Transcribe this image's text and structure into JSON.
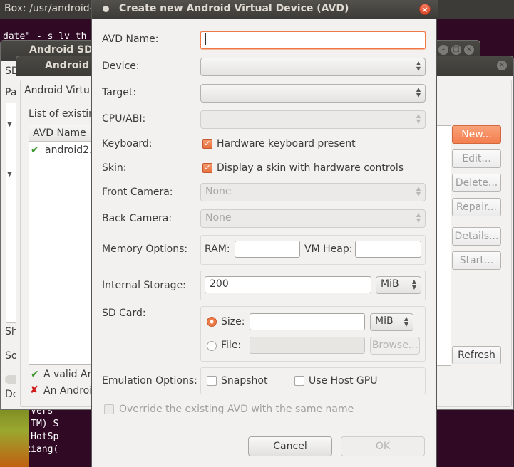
{
  "terminal": {
    "title": "Box: /usr/android-s",
    "lines": [
      "date\" - s lv th",
      "Java Vers",
      "Java(TM) S",
      "Java HotSp",
      "billxiang("
    ]
  },
  "sdk_manager": {
    "title": "Android SDK",
    "fragments": [
      "SD",
      "Pa",
      "Sh",
      "So",
      "Do"
    ]
  },
  "avd_manager": {
    "title": "Android V",
    "header": "Android Virtu",
    "list_caption": "List of existin",
    "column": "AVD Name",
    "rows": [
      "android2."
    ],
    "legend_valid": "A valid An",
    "legend_invalid": "An Androi",
    "buttons": {
      "new": "New...",
      "edit": "Edit...",
      "delete": "Delete...",
      "repair": "Repair...",
      "details": "Details...",
      "start": "Start..."
    }
  },
  "dialog": {
    "title": "Create new Android Virtual Device (AVD)",
    "avd_name": {
      "label": "AVD Name:",
      "value": ""
    },
    "device": {
      "label": "Device:",
      "value": ""
    },
    "target": {
      "label": "Target:",
      "value": ""
    },
    "cpu_abi": {
      "label": "CPU/ABI:",
      "value": ""
    },
    "keyboard": {
      "label": "Keyboard:",
      "option": "Hardware keyboard present",
      "checked": true
    },
    "skin": {
      "label": "Skin:",
      "option": "Display a skin with hardware controls",
      "checked": true
    },
    "front_camera": {
      "label": "Front Camera:",
      "value": "None"
    },
    "back_camera": {
      "label": "Back Camera:",
      "value": "None"
    },
    "memory": {
      "label": "Memory Options:",
      "ram_label": "RAM:",
      "ram_value": "",
      "heap_label": "VM Heap:",
      "heap_value": ""
    },
    "internal_storage": {
      "label": "Internal Storage:",
      "value": "200",
      "unit": "MiB"
    },
    "sd_card": {
      "label": "SD Card:",
      "size_label": "Size:",
      "size_value": "",
      "size_unit": "MiB",
      "file_label": "File:",
      "file_value": "",
      "browse": "Browse...",
      "selected": "size"
    },
    "emulation": {
      "label": "Emulation Options:",
      "snapshot": "Snapshot",
      "snapshot_checked": false,
      "host_gpu": "Use Host GPU",
      "host_gpu_checked": false
    },
    "override": {
      "label": "Override the existing AVD with the same name",
      "checked": false
    },
    "cancel": "Cancel",
    "ok": "OK"
  },
  "colors": {
    "accent": "#f07746",
    "title_bar": "#3c3b37",
    "terminal_bg": "#300a24"
  }
}
